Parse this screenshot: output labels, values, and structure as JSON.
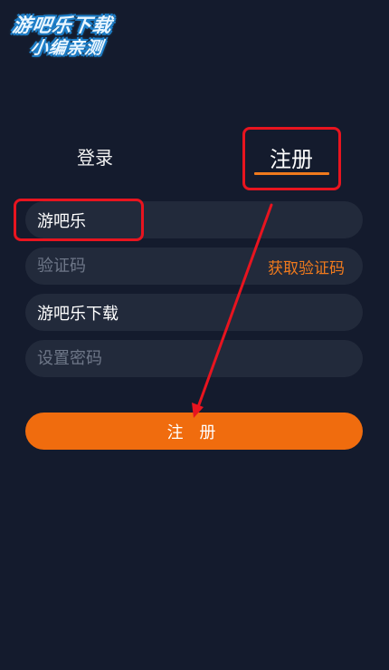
{
  "logo": {
    "line1": "游吧乐下载",
    "line2": "小编亲测"
  },
  "tabs": {
    "login_label": "登录",
    "register_label": "注册"
  },
  "form": {
    "username_value": "游吧乐",
    "code_placeholder": "验证码",
    "get_code_label": "获取验证码",
    "nickname_value": "游吧乐下载",
    "password_placeholder": "设置密码",
    "submit_label": "注 册"
  },
  "colors": {
    "background": "#141b2d",
    "field": "#222a3b",
    "accent": "#f06c0e",
    "annotation": "#e8141f"
  }
}
